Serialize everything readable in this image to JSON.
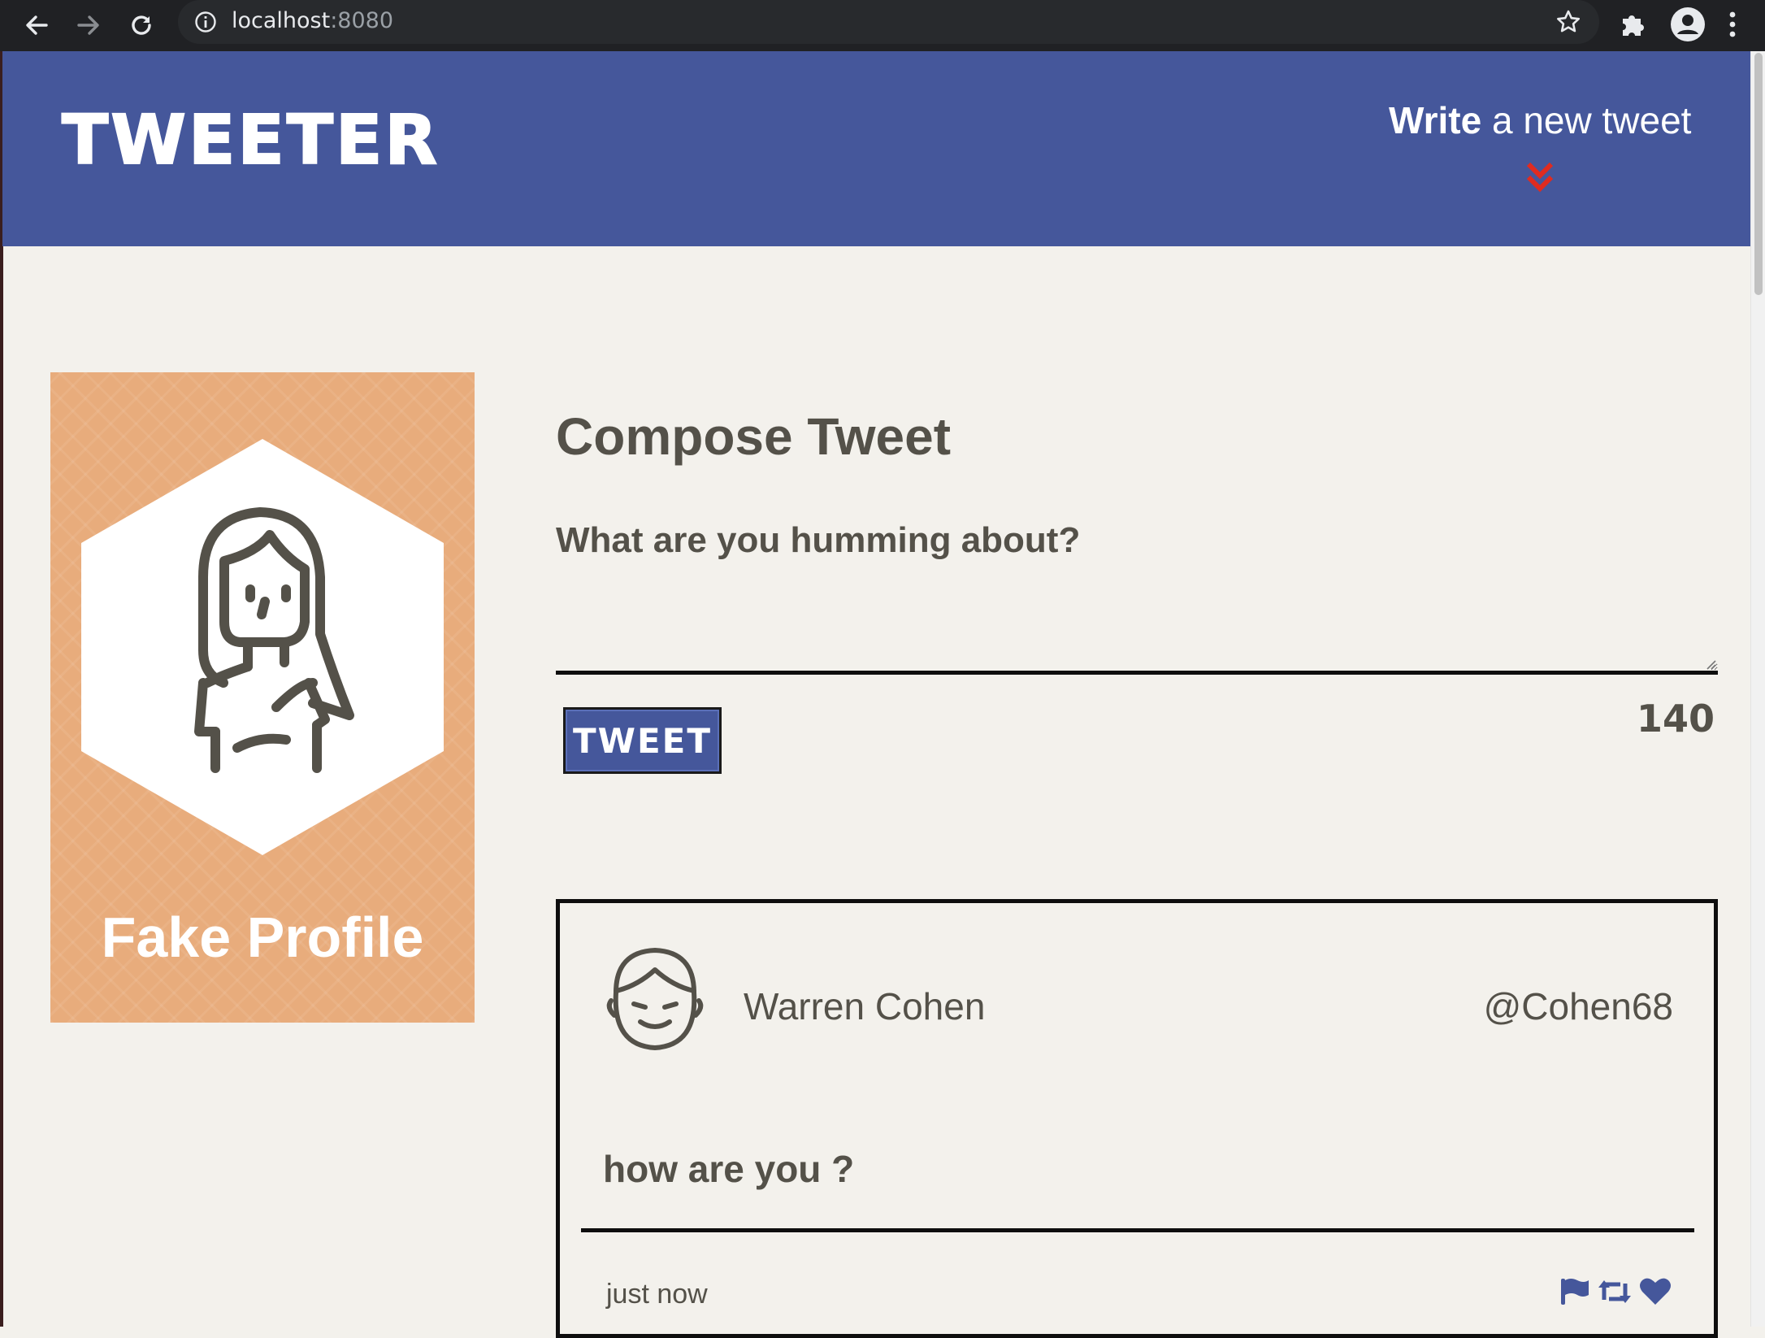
{
  "browser": {
    "url_host": "localhost",
    "url_port": ":8080"
  },
  "header": {
    "logo": "TWEETER",
    "write_bold": "Write",
    "write_rest": " a new tweet",
    "accent_color": "#e02b20",
    "brand_color": "#45579b"
  },
  "profile": {
    "name": "Fake Profile",
    "card_color": "#e8ac7c"
  },
  "compose": {
    "title": "Compose Tweet",
    "label": "What are you humming about?",
    "textarea_value": "",
    "button_label": "TWEET",
    "counter": "140"
  },
  "tweet": {
    "name": "Warren Cohen",
    "handle": "@Cohen68",
    "body": "how are you ?",
    "time": "just now",
    "actions": [
      "flag-icon",
      "retweet-icon",
      "heart-icon"
    ]
  }
}
